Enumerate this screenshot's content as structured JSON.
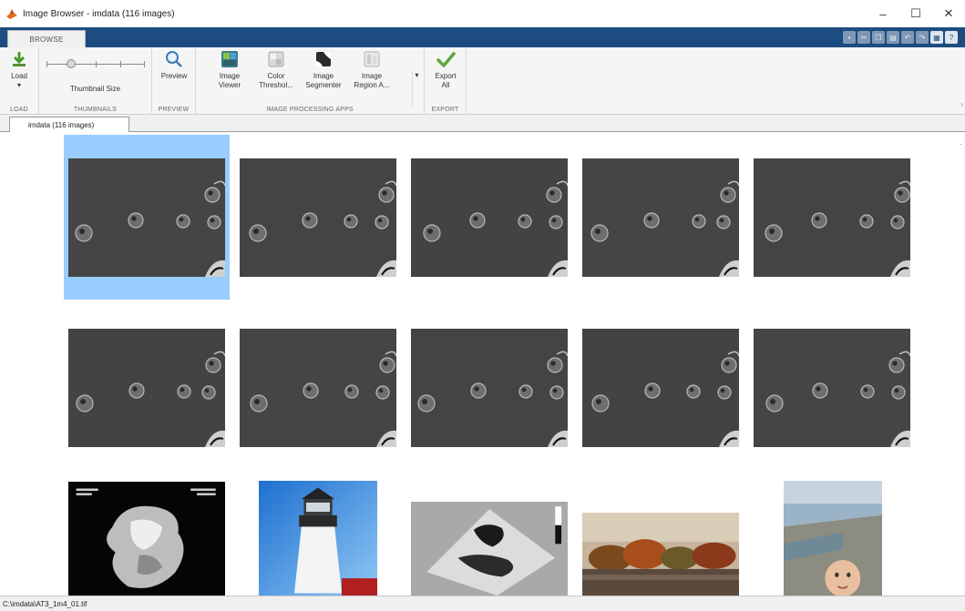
{
  "window": {
    "title": "Image Browser - imdata (116 images)",
    "controls": {
      "minimize": "–",
      "maximize": "☐",
      "close": "✕"
    }
  },
  "ribbon": {
    "tab": "BROWSE",
    "quick_access_icons": [
      "save-icon",
      "undo-icon",
      "redo-icon",
      "help-icon"
    ],
    "groups": {
      "load": {
        "label": "LOAD",
        "button": {
          "label": "Load",
          "menu_arrow": "▾",
          "icon": "load-arrow-icon"
        }
      },
      "thumbnails": {
        "label": "THUMBNAILS",
        "control": "Thumbnail Size",
        "slider_value": 0.22
      },
      "preview": {
        "label": "PREVIEW",
        "button": {
          "label": "Preview",
          "icon": "magnifier-icon"
        }
      },
      "apps": {
        "label": "IMAGE PROCESSING APPS",
        "buttons": [
          {
            "line1": "Image",
            "line2": "Viewer",
            "icon": "image-viewer-icon"
          },
          {
            "line1": "Color",
            "line2": "Threshol...",
            "icon": "color-thresholder-icon"
          },
          {
            "line1": "Image",
            "line2": "Segmenter",
            "icon": "image-segmenter-icon"
          },
          {
            "line1": "Image",
            "line2": "Region A...",
            "icon": "image-region-analyzer-icon"
          }
        ],
        "more": "▾"
      },
      "export": {
        "label": "EXPORT",
        "button": {
          "line1": "Export",
          "line2": "All",
          "icon": "checkmark-icon"
        }
      }
    }
  },
  "document_tab": {
    "label": "imdata (116 images)"
  },
  "thumbnails": {
    "selected_index": 0,
    "items_visible": 15
  },
  "status": {
    "path": "C:\\imdata\\AT3_1m4_01.tif"
  },
  "colors": {
    "ribbon_tab_strip": "#1d4c80",
    "selection": "#99ccff",
    "export_check": "#5aa83c"
  }
}
